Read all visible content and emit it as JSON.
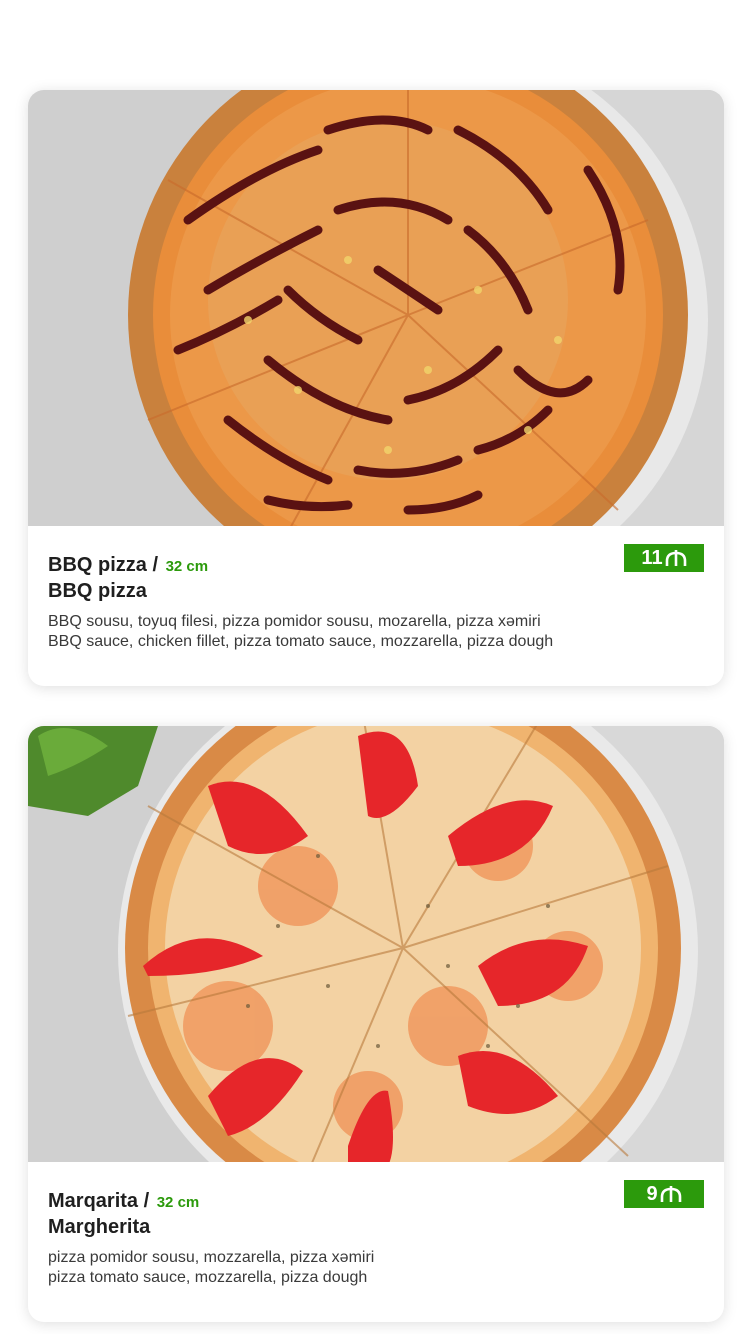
{
  "menu": {
    "items": [
      {
        "name_az": "BBQ pizza /",
        "size": "32 cm",
        "name_en": "BBQ pizza",
        "desc_az": "BBQ sousu, toyuq filesi, pizza pomidor sousu, mozarella, pizza xəmiri",
        "desc_en": "BBQ sauce, chicken fillet, pizza tomato sauce, mozzarella, pizza dough",
        "price": "11",
        "currency_icon": "manat-icon"
      },
      {
        "name_az": "Marqarita /",
        "size": "32 cm",
        "name_en": "Margherita",
        "desc_az": "pizza pomidor sousu, mozzarella, pizza xəmiri",
        "desc_en": "pizza tomato sauce, mozzarella, pizza dough",
        "price": "9",
        "currency_icon": "manat-icon"
      }
    ]
  },
  "colors": {
    "accent": "#2c9a0c",
    "title": "#1f1f1f",
    "text": "#3a3a3a"
  }
}
